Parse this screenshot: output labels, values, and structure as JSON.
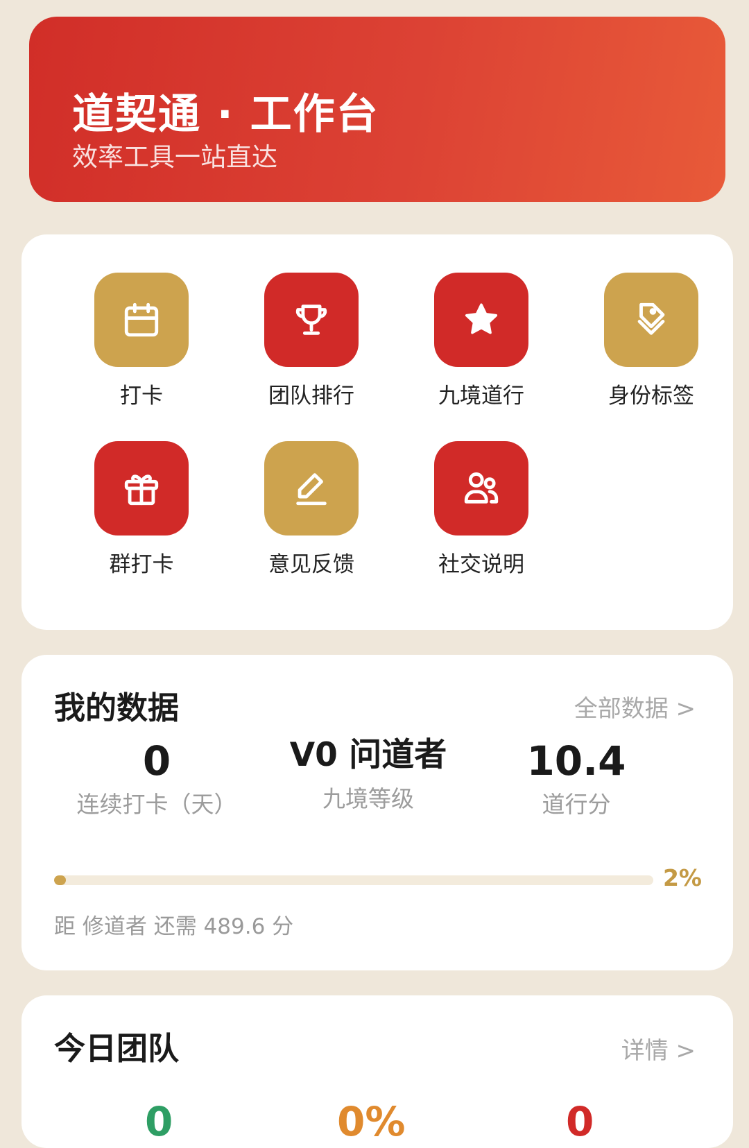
{
  "banner": {
    "title": "道契通 · 工作台",
    "subtitle": "效率工具一站直达"
  },
  "tools": [
    {
      "label": "打卡",
      "icon": "calendar-icon",
      "color": "#CDA34E"
    },
    {
      "label": "团队排行",
      "icon": "trophy-icon",
      "color": "#D12A28"
    },
    {
      "label": "九境道行",
      "icon": "star-icon",
      "color": "#D12A28"
    },
    {
      "label": "身份标签",
      "icon": "tag-icon",
      "color": "#CDA34E"
    },
    {
      "label": "群打卡",
      "icon": "gift-icon",
      "color": "#D12A28"
    },
    {
      "label": "意见反馈",
      "icon": "edit-icon",
      "color": "#CDA34E"
    },
    {
      "label": "社交说明",
      "icon": "users-icon",
      "color": "#D12A28"
    }
  ],
  "my_data": {
    "title": "我的数据",
    "link": "全部数据  >",
    "stats": [
      {
        "value": "0",
        "label": "连续打卡（天）"
      },
      {
        "value": "V0 问道者",
        "label": "九境等级"
      },
      {
        "value": "10.4",
        "label": "道行分"
      }
    ],
    "progress_percent": 2,
    "progress_label": "2%",
    "progress_note": "距 修道者 还需 489.6 分"
  },
  "team": {
    "title": "今日团队",
    "link": "详情 >",
    "values": [
      {
        "value": "0",
        "color": "#2E9E64"
      },
      {
        "value": "0%",
        "color": "#E08A2E"
      },
      {
        "value": "0",
        "color": "#D12A28"
      }
    ]
  }
}
